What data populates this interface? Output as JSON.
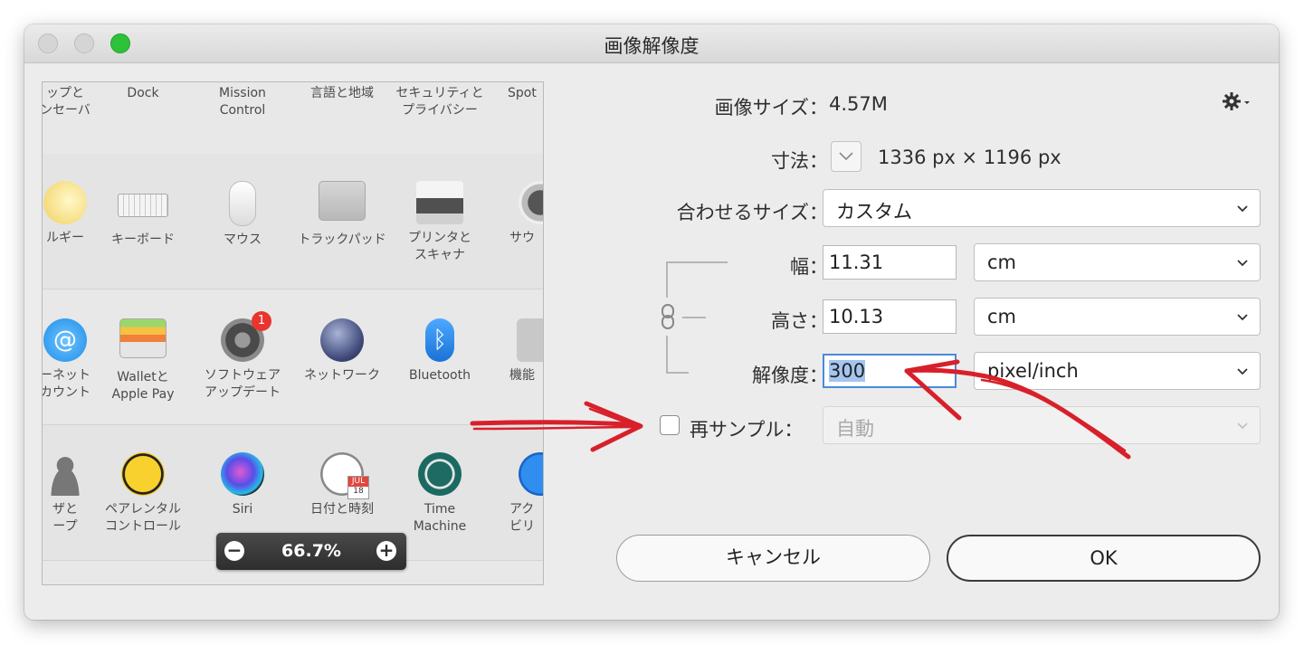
{
  "window": {
    "title": "画像解像度"
  },
  "preview": {
    "rows": [
      {
        "items": [
          "ップと\nンセーバ",
          "Dock",
          "Mission\nControl",
          "言語と地域",
          "セキュリティと\nプライバシー",
          "Spot"
        ]
      },
      {
        "items": [
          "ルギー",
          "キーボード",
          "マウス",
          "トラックパッド",
          "プリンタと\nスキャナ",
          "サウ"
        ]
      },
      {
        "items": [
          "ーネット\nカウント",
          "Walletと\nApple Pay",
          "ソフトウェア\nアップデート",
          "ネットワーク",
          "Bluetooth",
          "機能"
        ]
      },
      {
        "items": [
          "ザと\nープ",
          "ペアレンタル\nコントロール",
          "Siri",
          "日付と時刻",
          "Time\nMachine",
          "アク\nビリ"
        ]
      }
    ],
    "badge": "1",
    "calendar_month": "JUL",
    "calendar_day": "18",
    "zoom": {
      "value": "66.7%",
      "minus": "−",
      "plus": "+"
    }
  },
  "form": {
    "image_size_label": "画像サイズ：",
    "image_size_value": "4.57M",
    "dimensions_label": "寸法：",
    "dimensions_value": "1336 px × 1196 px",
    "fit_label": "合わせるサイズ：",
    "fit_value": "カスタム",
    "width_label": "幅：",
    "width_value": "11.31",
    "width_unit": "cm",
    "height_label": "高さ：",
    "height_value": "10.13",
    "height_unit": "cm",
    "resolution_label": "解像度：",
    "resolution_value": "300",
    "resolution_unit": "pixel/inch",
    "resample_label": "再サンプル：",
    "resample_value": "自動",
    "resample_checked": false
  },
  "buttons": {
    "cancel": "キャンセル",
    "ok": "OK"
  },
  "colors": {
    "close_zoom_green": "#2ec13a",
    "annotation_red": "#d8202a",
    "focus_blue": "#4a8ad8"
  }
}
